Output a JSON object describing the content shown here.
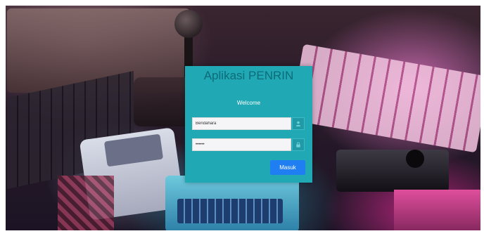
{
  "login": {
    "title": "Aplikasi PENRIN",
    "subtitle": "Welcome",
    "username": {
      "value": "Bendahara",
      "icon": "user-icon"
    },
    "password": {
      "value": "••••••",
      "icon": "lock-icon"
    },
    "submit_label": "Masuk"
  },
  "colors": {
    "card": "#20a8b4",
    "title": "#0e6b78",
    "button": "#1f7ff2"
  }
}
